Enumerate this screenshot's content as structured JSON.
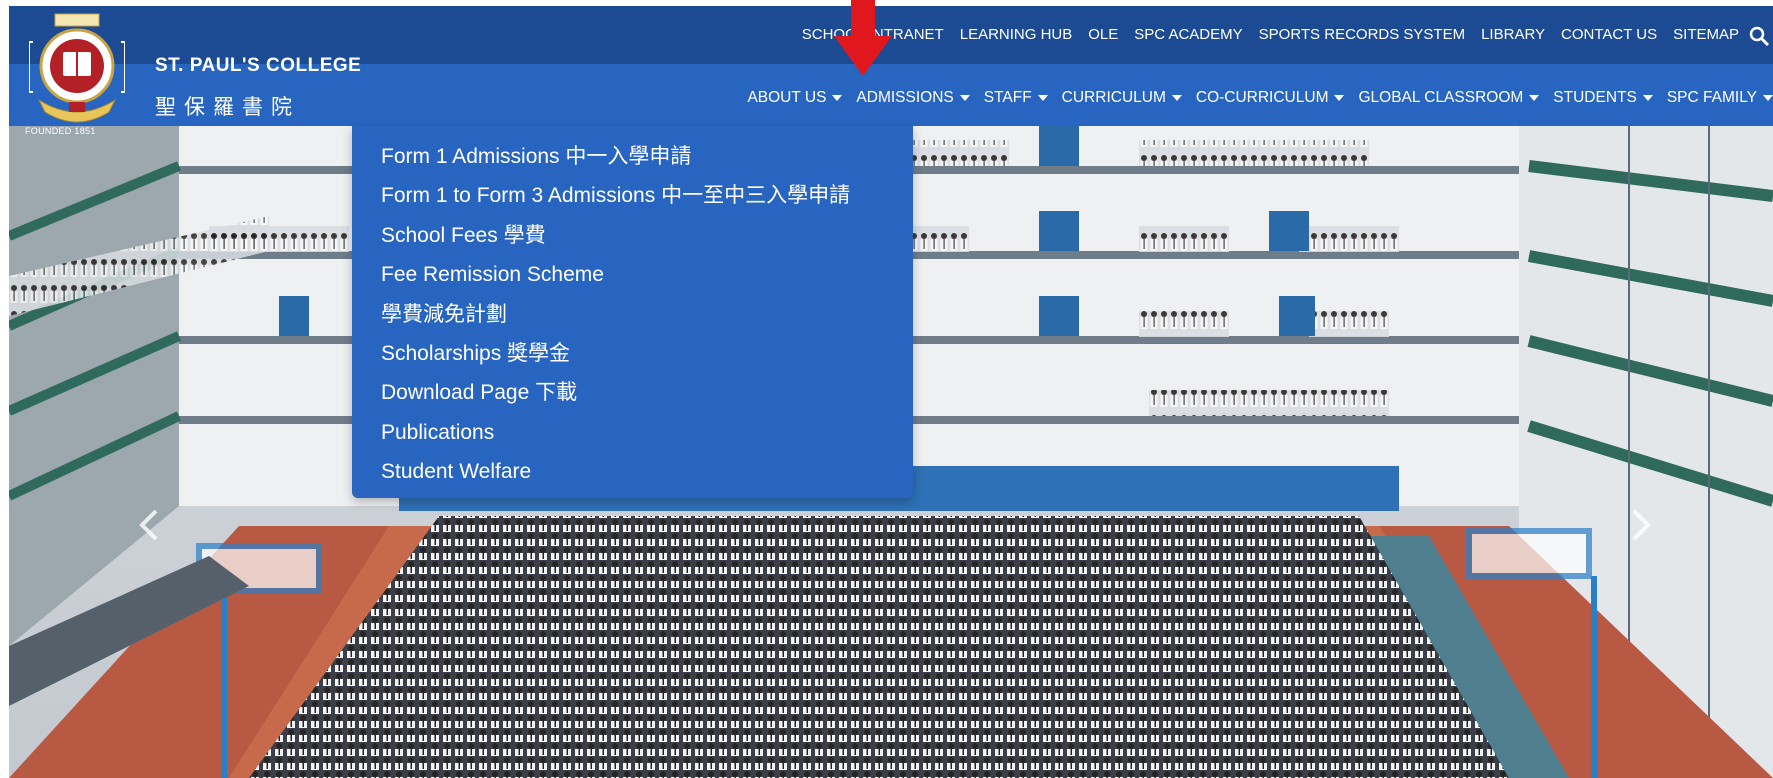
{
  "school": {
    "name_en": "ST. PAUL'S COLLEGE",
    "name_zh": "聖保羅書院",
    "founded": "FOUNDED 1851"
  },
  "top_links": [
    "SCHOOL INTRANET",
    "LEARNING HUB",
    "OLE",
    "SPC ACADEMY",
    "SPORTS RECORDS SYSTEM",
    "LIBRARY",
    "CONTACT US",
    "SITEMAP"
  ],
  "main_nav": [
    "ABOUT US",
    "ADMISSIONS",
    "STAFF",
    "CURRICULUM",
    "CO-CURRICULUM",
    "GLOBAL CLASSROOM",
    "STUDENTS",
    "SPC FAMILY"
  ],
  "admissions_menu": [
    "Form 1 Admissions 中一入學申請",
    "Form 1 to Form 3 Admissions 中一至中三入學申請",
    "School Fees 學費",
    "Fee Remission Scheme",
    "學費減免計劃",
    "Scholarships 獎學金",
    "Download Page 下載",
    "Publications",
    "Student Welfare"
  ],
  "icons": {
    "search": "search-icon",
    "caret": "caret-down-icon",
    "carousel_prev": "chevron-left-icon",
    "carousel_next": "chevron-right-icon",
    "annotation": "red-arrow-icon"
  },
  "colors": {
    "topbar": "#1c4a93",
    "navbar": "#2765c0",
    "dropdown": "#2765c0",
    "annotation": "#e0171c"
  }
}
